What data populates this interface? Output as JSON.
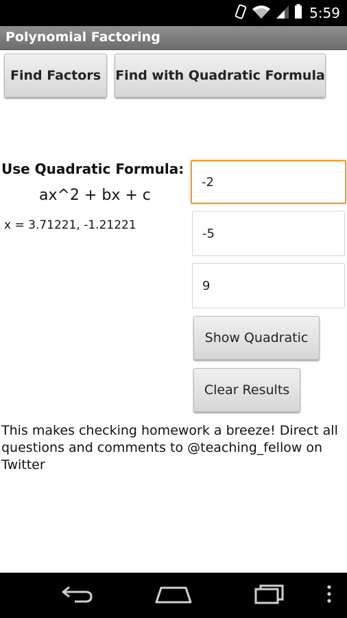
{
  "status_bar": {
    "time": "5:59",
    "icons": [
      "vibrate-icon",
      "wifi-icon",
      "signal-icon",
      "battery-icon"
    ]
  },
  "app": {
    "title": "Polynomial Factoring"
  },
  "toolbar": {
    "find_factors_label": "Find Factors",
    "find_quadratic_label": "Find with Quadratic Formula"
  },
  "quadratic": {
    "heading": "Use Quadratic Formula:",
    "formula": "ax^2 + bx + c",
    "result": "x = 3.71221, -1.21221",
    "inputs": {
      "a": "-2",
      "b": "-5",
      "c": "9"
    },
    "show_label": "Show Quadratic",
    "clear_label": "Clear Results"
  },
  "footer": {
    "text": "This makes checking homework a breeze! Direct all questions and comments to @teaching_fellow on Twitter"
  },
  "nav": {
    "icons": [
      "back-icon",
      "home-icon",
      "recent-apps-icon",
      "menu-icon"
    ]
  },
  "colors": {
    "focus_accent": "#f59a23",
    "title_bar": "#7d7d7d",
    "system_bar": "#000000"
  }
}
